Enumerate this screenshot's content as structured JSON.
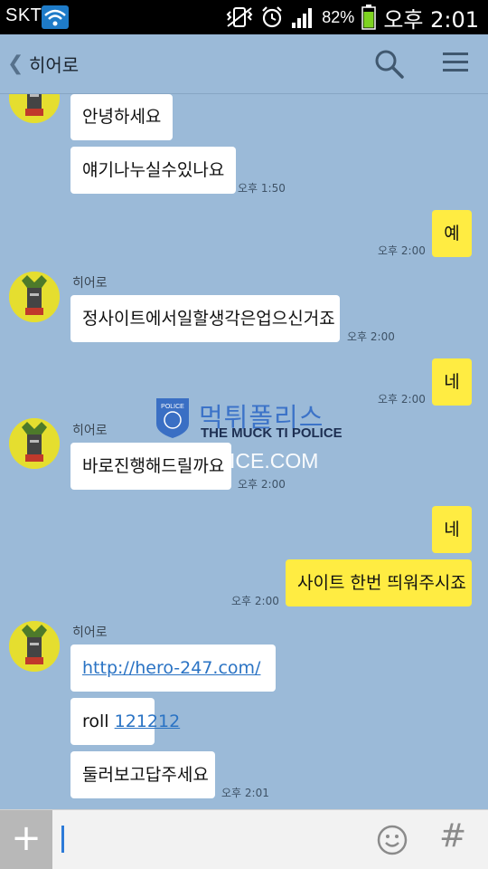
{
  "status_bar": {
    "carrier": "SKT",
    "battery_percent": "82%",
    "time": "오후 2:01"
  },
  "header": {
    "title": "히어로"
  },
  "messages": [
    {
      "sender": "",
      "text": "안녕하세요",
      "time": ""
    },
    {
      "sender": "",
      "text": "얘기나누실수있나요",
      "time": "오후 1:50"
    },
    {
      "sender": "me",
      "text": "예",
      "time": "오후 2:00"
    },
    {
      "sender": "히어로",
      "text": "정사이트에서일할생각은업으신거죠",
      "time": "오후 2:00"
    },
    {
      "sender": "me",
      "text": "네",
      "time": "오후 2:00"
    },
    {
      "sender": "히어로",
      "text": "바로진행해드릴까요",
      "time": "오후 2:00"
    },
    {
      "sender": "me",
      "text": "네",
      "time": ""
    },
    {
      "sender": "me",
      "text": "사이트 한번 띄워주시죠",
      "time": "오후 2:00"
    },
    {
      "sender": "히어로",
      "text": "http://hero-247.com/",
      "time": ""
    },
    {
      "sender": "",
      "text_prefix": "roll ",
      "text_link": "121212",
      "time": ""
    },
    {
      "sender": "",
      "text": "둘러보고답주세요",
      "time": "오후 2:01"
    }
  ],
  "watermark": {
    "badge": "POLICE",
    "title": "먹튀폴리스",
    "subtitle": "THE MUCK TI POLICE",
    "domain": "ICE.COM"
  },
  "input": {
    "placeholder": "",
    "plus_label": "+",
    "sharp_label": "#"
  },
  "icons": {
    "back": "chevron-left-icon",
    "search": "search-icon",
    "menu": "menu-icon",
    "emoji": "smiley-icon",
    "plus": "plus-icon"
  },
  "colors": {
    "background": "#9bbad8",
    "my_bubble": "#ffec42",
    "other_bubble": "#ffffff",
    "link": "#2a73c4"
  }
}
